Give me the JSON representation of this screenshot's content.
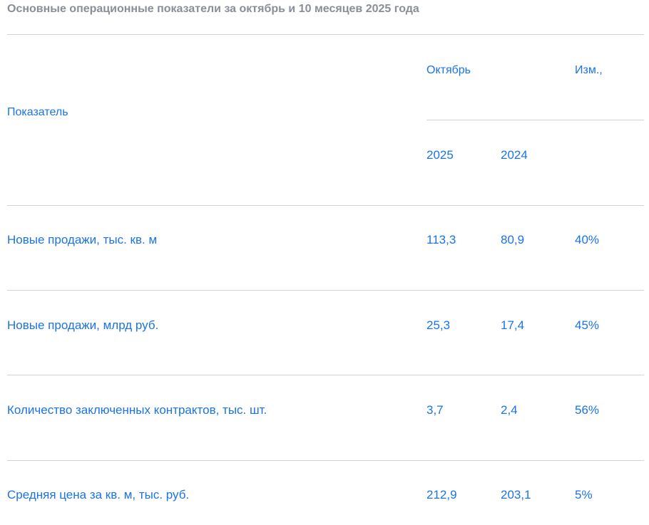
{
  "title": "Основные операционные показатели за октябрь и 10 месяцев 2025 года",
  "colors": {
    "title": "#8a8e99",
    "text_accent": "#1a73e8",
    "divider": "#cfd2d8"
  },
  "table": {
    "header": {
      "indicator": "Показатель",
      "period": "Октябрь",
      "change": "Изм.,",
      "year_current": "2025",
      "year_previous": "2024"
    },
    "rows": [
      {
        "label": "Новые продажи, тыс. кв. м",
        "current": "113,3",
        "previous": "80,9",
        "change": "40%"
      },
      {
        "label": "Новые продажи, млрд руб.",
        "current": "25,3",
        "previous": "17,4",
        "change": "45%"
      },
      {
        "label": "Количество заключенных контрактов, тыс. шт.",
        "current": "3,7",
        "previous": "2,4",
        "change": "56%"
      },
      {
        "label": "Средняя цена за кв. м, тыс. руб.",
        "current": "212,9",
        "previous": "203,1",
        "change": "5%"
      }
    ]
  }
}
